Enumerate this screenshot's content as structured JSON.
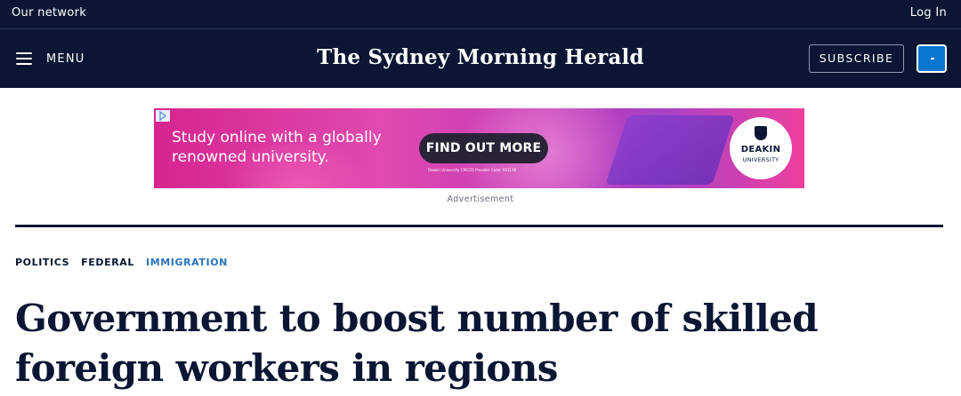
{
  "topbar": {
    "network_label": "Our network",
    "login_label": "Log In"
  },
  "header": {
    "menu_label": "MENU",
    "masthead": "The Sydney Morning Herald",
    "subscribe_label": "SUBSCRIBE",
    "account_icon": "account-icon"
  },
  "ad": {
    "headline": "Study online with a globally renowned university.",
    "cta_label": "FIND OUT MORE",
    "fine_print": "Deakin University CRICOS Provider Code: 00113B",
    "logo_name": "DEAKIN",
    "logo_sub": "UNIVERSITY",
    "label": "Advertisement"
  },
  "article": {
    "tags": [
      "POLITICS",
      "FEDERAL",
      "IMMIGRATION"
    ],
    "title": "Government to boost number of skilled foreign workers in regions"
  },
  "colors": {
    "navy": "#0a1633",
    "accent_blue": "#0a74d1",
    "tag_active": "#2a73b8"
  }
}
